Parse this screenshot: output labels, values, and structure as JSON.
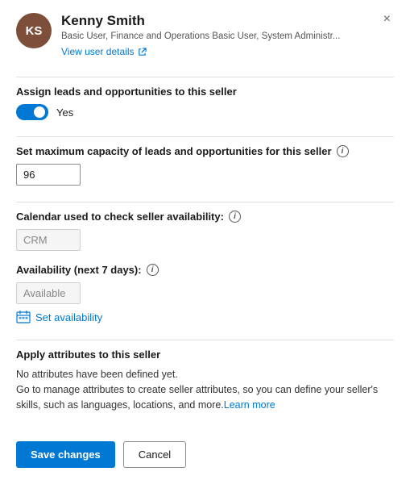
{
  "header": {
    "avatar_initials": "KS",
    "user_name": "Kenny Smith",
    "user_roles": "Basic User, Finance and Operations Basic User, System Administr...",
    "view_user_link_text": "View user details",
    "close_label": "×"
  },
  "sections": {
    "assign_leads": {
      "label": "Assign leads and opportunities to this seller",
      "toggle_value": "Yes"
    },
    "max_capacity": {
      "label": "Set maximum capacity of leads and opportunities for this seller",
      "input_value": "96",
      "input_placeholder": "96"
    },
    "calendar": {
      "label": "Calendar used to check seller availability:",
      "input_value": "CRM",
      "input_placeholder": "CRM"
    },
    "availability": {
      "label": "Availability (next 7 days):",
      "input_value": "Available",
      "input_placeholder": "Available",
      "set_availability_text": "Set availability"
    },
    "attributes": {
      "label": "Apply attributes to this seller",
      "no_attributes_text": "No attributes have been defined yet.",
      "description": "Go to manage attributes to create seller attributes, so you can define your seller's skills, such as languages, locations, and more.",
      "learn_more_text": "Learn more"
    }
  },
  "footer": {
    "save_label": "Save changes",
    "cancel_label": "Cancel"
  }
}
